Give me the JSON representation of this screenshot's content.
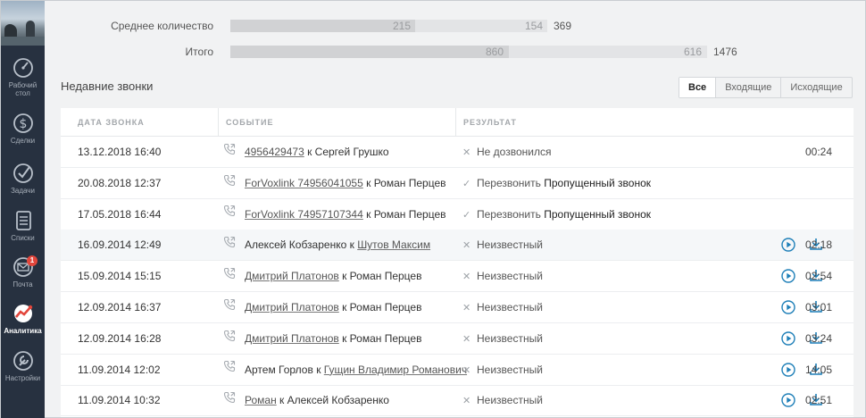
{
  "sidebar": {
    "items": [
      {
        "label": "Рабочий стол",
        "icon": "speedometer-icon"
      },
      {
        "label": "Сделки",
        "icon": "dollar-icon"
      },
      {
        "label": "Задачи",
        "icon": "checkmark-circle-icon"
      },
      {
        "label": "Списки",
        "icon": "contact-book-icon"
      },
      {
        "label": "Почта",
        "icon": "mail-icon",
        "badge": "1"
      },
      {
        "label": "Аналитика",
        "icon": "analytics-icon",
        "active": true
      },
      {
        "label": "Настройки",
        "icon": "wrench-icon"
      }
    ]
  },
  "stats": {
    "average": {
      "label": "Среднее количество",
      "a": "215",
      "b": "154",
      "total": "369",
      "a_value": 215,
      "b_value": 154
    },
    "total": {
      "label": "Итого",
      "a": "860",
      "b": "616",
      "total": "1476",
      "a_value": 860,
      "b_value": 616
    }
  },
  "recent": {
    "title": "Недавние звонки",
    "filters": [
      {
        "label": "Все",
        "active": true
      },
      {
        "label": "Входящие",
        "active": false
      },
      {
        "label": "Исходящие",
        "active": false
      }
    ],
    "columns": {
      "date": "ДАТА ЗВОНКА",
      "event": "СОБЫТИЕ",
      "result": "РЕЗУЛЬТАТ"
    },
    "rows": [
      {
        "date": "13.12.2018 16:40",
        "from": "4956429473",
        "from_link": true,
        "sep": " к ",
        "to": "Сергей Грушко",
        "to_link": false,
        "mark": "✕",
        "result": "Не дозвонился",
        "extra": "",
        "duration": "00:24",
        "media": false,
        "hl": false
      },
      {
        "date": "20.08.2018 12:37",
        "from": "ForVoxlink 74956041055",
        "from_link": true,
        "sep": " к ",
        "to": "Роман Перцев",
        "to_link": false,
        "mark": "✓",
        "result": "Перезвонить",
        "extra": "Пропущенный звонок",
        "duration": "",
        "media": false,
        "hl": false
      },
      {
        "date": "17.05.2018 16:44",
        "from": "ForVoxlink 74957107344",
        "from_link": true,
        "sep": " к ",
        "to": "Роман Перцев",
        "to_link": false,
        "mark": "✓",
        "result": "Перезвонить",
        "extra": "Пропущенный звонок",
        "duration": "",
        "media": false,
        "hl": false
      },
      {
        "date": "16.09.2014 12:49",
        "from": "Алексей Кобзаренко",
        "from_link": false,
        "sep": " к ",
        "to": "Шутов Максим",
        "to_link": true,
        "mark": "✕",
        "result": "Неизвестный",
        "extra": "",
        "duration": "02:18",
        "media": true,
        "hl": true
      },
      {
        "date": "15.09.2014 15:15",
        "from": "Дмитрий Платонов",
        "from_link": true,
        "sep": " к ",
        "to": "Роман Перцев",
        "to_link": false,
        "mark": "✕",
        "result": "Неизвестный",
        "extra": "",
        "duration": "02:54",
        "media": true,
        "hl": false
      },
      {
        "date": "12.09.2014 16:37",
        "from": "Дмитрий Платонов",
        "from_link": true,
        "sep": " к ",
        "to": "Роман Перцев",
        "to_link": false,
        "mark": "✕",
        "result": "Неизвестный",
        "extra": "",
        "duration": "03:01",
        "media": true,
        "hl": false
      },
      {
        "date": "12.09.2014 16:28",
        "from": "Дмитрий Платонов",
        "from_link": true,
        "sep": " к ",
        "to": "Роман Перцев",
        "to_link": false,
        "mark": "✕",
        "result": "Неизвестный",
        "extra": "",
        "duration": "03:24",
        "media": true,
        "hl": false
      },
      {
        "date": "11.09.2014 12:02",
        "from": "Артем Горлов",
        "from_link": false,
        "sep": " к ",
        "to": "Гущин Владимир Романович",
        "to_link": true,
        "mark": "✕",
        "result": "Неизвестный",
        "extra": "",
        "duration": "14:05",
        "media": true,
        "hl": false
      },
      {
        "date": "11.09.2014 10:32",
        "from": "Роман",
        "from_link": true,
        "sep": " к ",
        "to": "Алексей Кобзаренко",
        "to_link": false,
        "mark": "✕",
        "result": "Неизвестный",
        "extra": "",
        "duration": "02:51",
        "media": true,
        "hl": false
      }
    ]
  },
  "colors": {
    "sidebar": "#273140",
    "accent": "#1e7fb8",
    "bar_a": "#d1d2d4",
    "bar_b": "#e3e4e6"
  }
}
